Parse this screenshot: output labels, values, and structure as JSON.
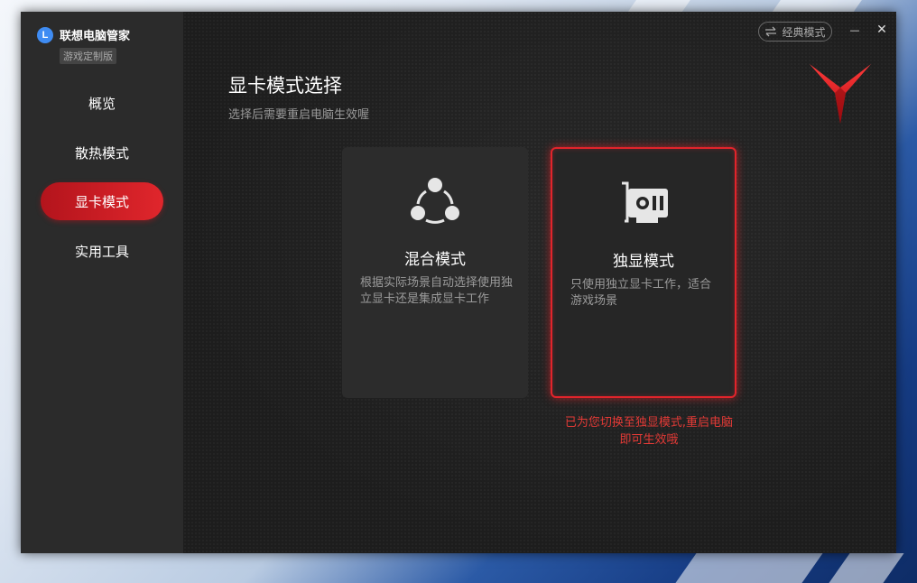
{
  "app": {
    "name": "联想电脑管家",
    "edition": "游戏定制版",
    "logo_letter": "L"
  },
  "sidebar": {
    "items": [
      {
        "label": "概览",
        "active": false
      },
      {
        "label": "散热模式",
        "active": false
      },
      {
        "label": "显卡模式",
        "active": true
      },
      {
        "label": "实用工具",
        "active": false
      }
    ]
  },
  "header": {
    "classic_mode_label": "经典模式",
    "minimize_glyph": "—",
    "close_glyph": "✕"
  },
  "page": {
    "title": "显卡模式选择",
    "subtitle": "选择后需要重启电脑生效喔"
  },
  "cards": [
    {
      "title": "混合模式",
      "desc": "根据实际场景自动选择使用独立显卡还是集成显卡工作",
      "icon": "hybrid-nodes-icon",
      "selected": false
    },
    {
      "title": "独显模式",
      "desc": "只使用独立显卡工作，适合游戏场景",
      "icon": "graphics-card-icon",
      "selected": true
    }
  ],
  "notice": {
    "line1": "已为您切换至独显模式,重启电脑",
    "line2": "即可生效哦"
  },
  "colors": {
    "accent": "#e2242b",
    "logo_blue": "#3f8cf3",
    "sidebar_bg": "#2b2b2b",
    "main_bg": "#1d1d1d"
  }
}
